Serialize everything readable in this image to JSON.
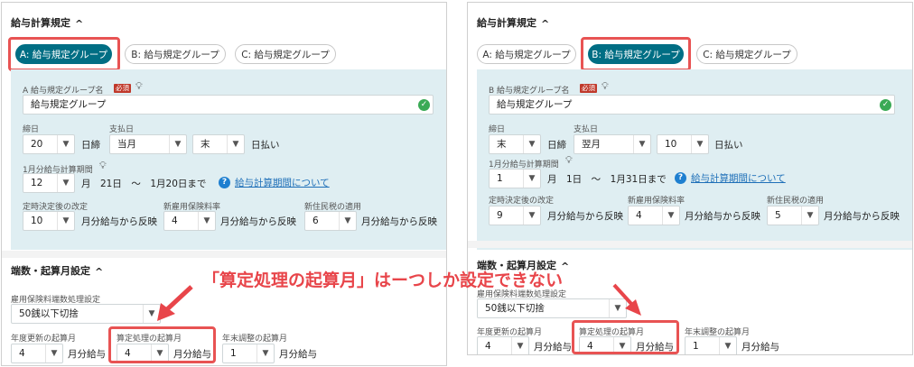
{
  "callout": "「算定処理の起算月」はーつしか設定できない",
  "left": {
    "section_title": "給与計算規定",
    "tabs": [
      "A: 給与規定グループ",
      "B: 給与規定グループ",
      "C: 給与規定グループ"
    ],
    "active_tab": "A",
    "group_name_label": "A 給与規定グループ名",
    "required": "必須",
    "group_name_value": "給与規定グループ",
    "closing_label": "締日",
    "closing_value": "20",
    "closing_suffix": "日締",
    "payday_label": "支払日",
    "payday_month": "当月",
    "payday_day": "末",
    "payday_suffix": "日払い",
    "period_label": "1月分給与計算期間",
    "period_month": "12",
    "period_text": "月　21日　～　1月20日まで",
    "period_link": "給与計算期間について",
    "fixed_label": "定時決定後の改定",
    "fixed_value": "10",
    "fixed_suffix": "月分給与から反映",
    "ins_label": "新雇用保険料率",
    "ins_value": "4",
    "ins_suffix": "月分給与から反映",
    "tax_label": "新住民税の適用",
    "tax_value": "6",
    "tax_suffix": "月分給与から反映",
    "section2_title": "端数・起算月設定",
    "rounding_label": "雇用保険料端数処理設定",
    "rounding_value": "50銭以下切捨",
    "year_label": "年度更新の起算月",
    "year_value": "4",
    "year_suffix": "月分給与",
    "calc_label": "算定処理の起算月",
    "calc_value": "4",
    "calc_suffix": "月分給与",
    "adj_label": "年末調整の起算月",
    "adj_value": "1",
    "adj_suffix": "月分給与"
  },
  "right": {
    "section_title": "給与計算規定",
    "tabs": [
      "A: 給与規定グループ",
      "B: 給与規定グループ",
      "C: 給与規定グループ"
    ],
    "active_tab": "B",
    "group_name_label": "B 給与規定グループ名",
    "required": "必須",
    "group_name_value": "給与規定グループ",
    "closing_label": "締日",
    "closing_value": "末",
    "closing_suffix": "日締",
    "payday_label": "支払日",
    "payday_month": "翌月",
    "payday_day": "10",
    "payday_suffix": "日払い",
    "period_label": "1月分給与計算期間",
    "period_month": "1",
    "period_text": "月　1日　～　1月31日まで",
    "period_link": "給与計算期間について",
    "fixed_label": "定時決定後の改定",
    "fixed_value": "9",
    "fixed_suffix": "月分給与から反映",
    "ins_label": "新雇用保険料率",
    "ins_value": "4",
    "ins_suffix": "月分給与から反映",
    "tax_label": "新住民税の適用",
    "tax_value": "5",
    "tax_suffix": "月分給与から反映",
    "section2_title": "端数・起算月設定",
    "rounding_label": "雇用保険料端数処理設定",
    "rounding_value": "50銭以下切捨",
    "year_label": "年度更新の起算月",
    "year_value": "4",
    "year_suffix": "月分給与",
    "calc_label": "算定処理の起算月",
    "calc_value": "4",
    "calc_suffix": "月分給与",
    "adj_label": "年末調整の起算月",
    "adj_value": "1",
    "adj_suffix": "月分給与"
  },
  "colors": {
    "accent": "#006e84",
    "highlight": "#e85353",
    "panel_bg": "#dfeef2"
  }
}
